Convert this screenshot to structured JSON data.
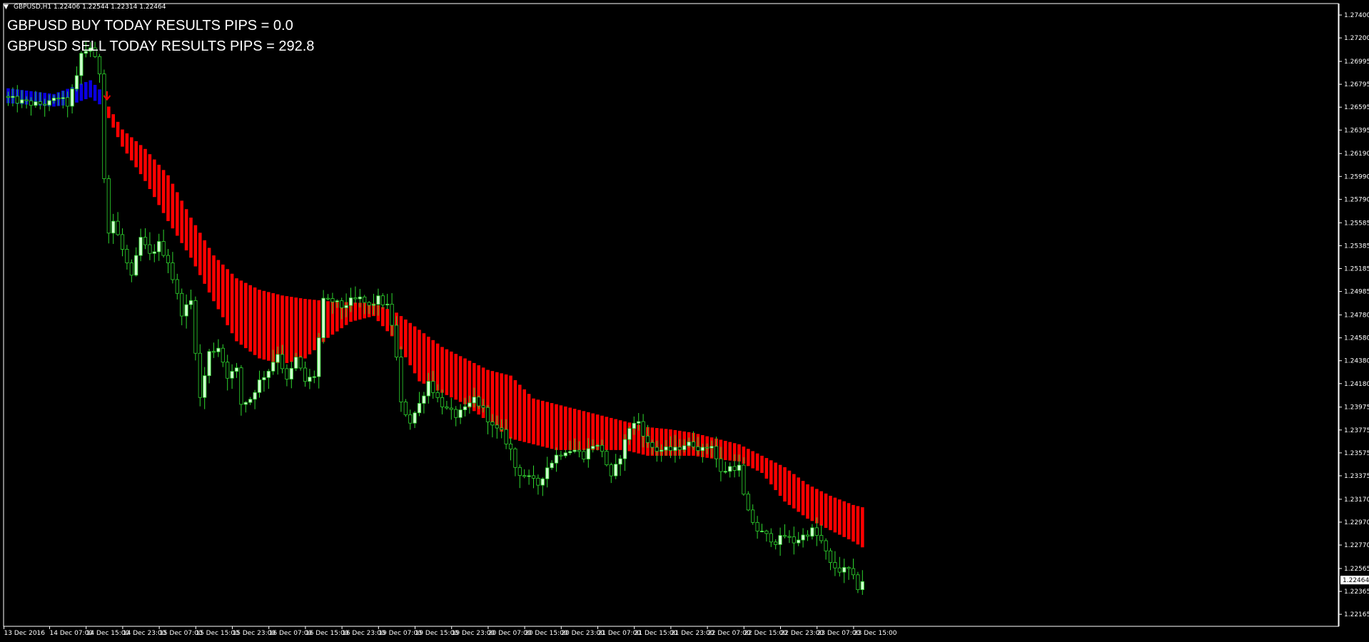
{
  "window": {
    "symbol_line": "GBPUSD,H1  1.22406 1.22544 1.22314 1.22464",
    "menu_glyph": "▼"
  },
  "overlay": {
    "buy_text": "GBPUSD BUY TODAY RESULTS PIPS = 0.0",
    "sell_text": "GBPUSD SELL TODAY RESULTS PIPS = 292.8"
  },
  "colors": {
    "background": "#000000",
    "frame": "#ffffff",
    "bull_candle": "#ccffcc",
    "bear_candle": "#000000",
    "wick": "#2ed62e",
    "ribbon_buy": "#0a00e0",
    "ribbon_sell": "#ff0000",
    "signal_arrow": "#ff0000",
    "text": "#ffffff"
  },
  "chart_data": {
    "type": "candlestick",
    "symbol": "GBPUSD",
    "timeframe": "H1",
    "ohlc_header": {
      "open": 1.22406,
      "high": 1.22544,
      "low": 1.22314,
      "close": 1.22464
    },
    "current_price_label": "1.22464",
    "ylim": [
      1.2206,
      1.275
    ],
    "y_ticks": [
      "1.27400",
      "1.27200",
      "1.26995",
      "1.26795",
      "1.26595",
      "1.26395",
      "1.26190",
      "1.25990",
      "1.25790",
      "1.25585",
      "1.25385",
      "1.25185",
      "1.24985",
      "1.24780",
      "1.24580",
      "1.24380",
      "1.24180",
      "1.23975",
      "1.23775",
      "1.23575",
      "1.23375",
      "1.23170",
      "1.22970",
      "1.22770",
      "1.22565",
      "1.22365",
      "1.22165"
    ],
    "x_ticks": [
      {
        "label": "13 Dec 2016",
        "index": 0
      },
      {
        "label": "14 Dec 07:00",
        "index": 10
      },
      {
        "label": "14 Dec 15:00",
        "index": 18
      },
      {
        "label": "14 Dec 23:00",
        "index": 26
      },
      {
        "label": "15 Dec 07:00",
        "index": 34
      },
      {
        "label": "15 Dec 15:00",
        "index": 42
      },
      {
        "label": "15 Dec 23:00",
        "index": 50
      },
      {
        "label": "16 Dec 07:00",
        "index": 58
      },
      {
        "label": "16 Dec 15:00",
        "index": 66
      },
      {
        "label": "16 Dec 23:00",
        "index": 74
      },
      {
        "label": "19 Dec 07:00",
        "index": 82
      },
      {
        "label": "19 Dec 15:00",
        "index": 90
      },
      {
        "label": "19 Dec 23:00",
        "index": 98
      },
      {
        "label": "20 Dec 07:00",
        "index": 106
      },
      {
        "label": "20 Dec 15:00",
        "index": 114
      },
      {
        "label": "20 Dec 23:00",
        "index": 122
      },
      {
        "label": "21 Dec 07:00",
        "index": 130
      },
      {
        "label": "21 Dec 15:00",
        "index": 138
      },
      {
        "label": "21 Dec 23:00",
        "index": 146
      },
      {
        "label": "22 Dec 07:00",
        "index": 154
      },
      {
        "label": "22 Dec 15:00",
        "index": 162
      },
      {
        "label": "22 Dec 23:00",
        "index": 170
      },
      {
        "label": "23 Dec 07:00",
        "index": 178
      },
      {
        "label": "23 Dec 15:00",
        "index": 186
      }
    ],
    "candle_count": 188,
    "close_anchors": [
      [
        0,
        1.2667
      ],
      [
        3,
        1.2664
      ],
      [
        6,
        1.2662
      ],
      [
        9,
        1.2663
      ],
      [
        11,
        1.2668
      ],
      [
        13,
        1.2662
      ],
      [
        15,
        1.2685
      ],
      [
        16,
        1.2706
      ],
      [
        18,
        1.2712
      ],
      [
        20,
        1.269
      ],
      [
        21,
        1.26
      ],
      [
        22,
        1.255
      ],
      [
        23,
        1.256
      ],
      [
        25,
        1.2535
      ],
      [
        27,
        1.251
      ],
      [
        29,
        1.2545
      ],
      [
        31,
        1.253
      ],
      [
        33,
        1.254
      ],
      [
        35,
        1.2525
      ],
      [
        36,
        1.251
      ],
      [
        38,
        1.248
      ],
      [
        40,
        1.249
      ],
      [
        42,
        1.2405
      ],
      [
        44,
        1.2445
      ],
      [
        46,
        1.245
      ],
      [
        48,
        1.2425
      ],
      [
        50,
        1.243
      ],
      [
        51,
        1.24
      ],
      [
        53,
        1.2405
      ],
      [
        55,
        1.242
      ],
      [
        57,
        1.243
      ],
      [
        59,
        1.2445
      ],
      [
        61,
        1.242
      ],
      [
        63,
        1.244
      ],
      [
        65,
        1.242
      ],
      [
        67,
        1.2425
      ],
      [
        69,
        1.249
      ],
      [
        71,
        1.249
      ],
      [
        73,
        1.2485
      ],
      [
        75,
        1.249
      ],
      [
        77,
        1.2492
      ],
      [
        79,
        1.2485
      ],
      [
        81,
        1.2492
      ],
      [
        83,
        1.2485
      ],
      [
        84,
        1.247
      ],
      [
        85,
        1.244
      ],
      [
        86,
        1.24
      ],
      [
        88,
        1.2385
      ],
      [
        90,
        1.24
      ],
      [
        92,
        1.242
      ],
      [
        94,
        1.2405
      ],
      [
        96,
        1.2395
      ],
      [
        98,
        1.239
      ],
      [
        100,
        1.2395
      ],
      [
        102,
        1.2405
      ],
      [
        104,
        1.2395
      ],
      [
        106,
        1.238
      ],
      [
        108,
        1.2375
      ],
      [
        110,
        1.236
      ],
      [
        111,
        1.2345
      ],
      [
        112,
        1.234
      ],
      [
        114,
        1.2335
      ],
      [
        116,
        1.233
      ],
      [
        118,
        1.2345
      ],
      [
        120,
        1.2355
      ],
      [
        122,
        1.236
      ],
      [
        124,
        1.236
      ],
      [
        126,
        1.2355
      ],
      [
        128,
        1.2365
      ],
      [
        130,
        1.236
      ],
      [
        132,
        1.2335
      ],
      [
        134,
        1.2355
      ],
      [
        136,
        1.238
      ],
      [
        138,
        1.2385
      ],
      [
        140,
        1.2365
      ],
      [
        142,
        1.236
      ],
      [
        144,
        1.236
      ],
      [
        146,
        1.236
      ],
      [
        148,
        1.2365
      ],
      [
        150,
        1.2365
      ],
      [
        152,
        1.236
      ],
      [
        154,
        1.2365
      ],
      [
        156,
        1.234
      ],
      [
        158,
        1.2345
      ],
      [
        160,
        1.2345
      ],
      [
        161,
        1.232
      ],
      [
        162,
        1.2305
      ],
      [
        164,
        1.229
      ],
      [
        166,
        1.2285
      ],
      [
        168,
        1.228
      ],
      [
        170,
        1.2285
      ],
      [
        172,
        1.228
      ],
      [
        174,
        1.2285
      ],
      [
        176,
        1.229
      ],
      [
        178,
        1.228
      ],
      [
        180,
        1.226
      ],
      [
        182,
        1.2255
      ],
      [
        184,
        1.2255
      ],
      [
        185,
        1.2248
      ],
      [
        186,
        1.224
      ],
      [
        187,
        1.2246
      ]
    ],
    "ribbon": {
      "description_values": "upper/lower band of the trend ribbon, in price",
      "buy_segment": {
        "from_index": 0,
        "to_index": 20
      },
      "sell_segment": {
        "from_index": 21,
        "to_index": 187
      },
      "upper_anchors": [
        [
          0,
          1.2676
        ],
        [
          10,
          1.2671
        ],
        [
          14,
          1.2677
        ],
        [
          18,
          1.2683
        ],
        [
          20,
          1.2675
        ],
        [
          21,
          1.2665
        ],
        [
          22,
          1.266
        ],
        [
          25,
          1.264
        ],
        [
          30,
          1.2623
        ],
        [
          35,
          1.26
        ],
        [
          40,
          1.2563
        ],
        [
          45,
          1.253
        ],
        [
          50,
          1.251
        ],
        [
          55,
          1.25
        ],
        [
          60,
          1.2495
        ],
        [
          65,
          1.2492
        ],
        [
          70,
          1.249
        ],
        [
          75,
          1.2489
        ],
        [
          80,
          1.2488
        ],
        [
          85,
          1.248
        ],
        [
          90,
          1.2465
        ],
        [
          95,
          1.245
        ],
        [
          100,
          1.244
        ],
        [
          105,
          1.243
        ],
        [
          110,
          1.2425
        ],
        [
          115,
          1.2405
        ],
        [
          120,
          1.24
        ],
        [
          125,
          1.2395
        ],
        [
          130,
          1.239
        ],
        [
          135,
          1.2385
        ],
        [
          140,
          1.238
        ],
        [
          145,
          1.2378
        ],
        [
          150,
          1.2375
        ],
        [
          155,
          1.237
        ],
        [
          160,
          1.2365
        ],
        [
          165,
          1.2355
        ],
        [
          170,
          1.2345
        ],
        [
          175,
          1.233
        ],
        [
          180,
          1.232
        ],
        [
          185,
          1.2312
        ],
        [
          187,
          1.231
        ]
      ],
      "lower_anchors": [
        [
          0,
          1.2663
        ],
        [
          10,
          1.266
        ],
        [
          14,
          1.2662
        ],
        [
          18,
          1.2668
        ],
        [
          20,
          1.2662
        ],
        [
          21,
          1.266
        ],
        [
          22,
          1.265
        ],
        [
          25,
          1.2625
        ],
        [
          30,
          1.2595
        ],
        [
          35,
          1.256
        ],
        [
          40,
          1.2528
        ],
        [
          45,
          1.249
        ],
        [
          50,
          1.2455
        ],
        [
          55,
          1.244
        ],
        [
          60,
          1.2435
        ],
        [
          65,
          1.244
        ],
        [
          70,
          1.2458
        ],
        [
          75,
          1.2472
        ],
        [
          80,
          1.2477
        ],
        [
          85,
          1.2455
        ],
        [
          90,
          1.242
        ],
        [
          95,
          1.241
        ],
        [
          100,
          1.24
        ],
        [
          105,
          1.2385
        ],
        [
          110,
          1.237
        ],
        [
          115,
          1.2365
        ],
        [
          120,
          1.236
        ],
        [
          125,
          1.236
        ],
        [
          130,
          1.236
        ],
        [
          135,
          1.236
        ],
        [
          140,
          1.2355
        ],
        [
          145,
          1.2355
        ],
        [
          150,
          1.2355
        ],
        [
          155,
          1.2352
        ],
        [
          160,
          1.235
        ],
        [
          165,
          1.234
        ],
        [
          170,
          1.2315
        ],
        [
          175,
          1.23
        ],
        [
          180,
          1.229
        ],
        [
          185,
          1.228
        ],
        [
          187,
          1.2275
        ]
      ]
    },
    "sell_signal": {
      "index": 21,
      "price": 1.2663,
      "marker": "down-arrow"
    },
    "grid": false,
    "legend": "none"
  }
}
